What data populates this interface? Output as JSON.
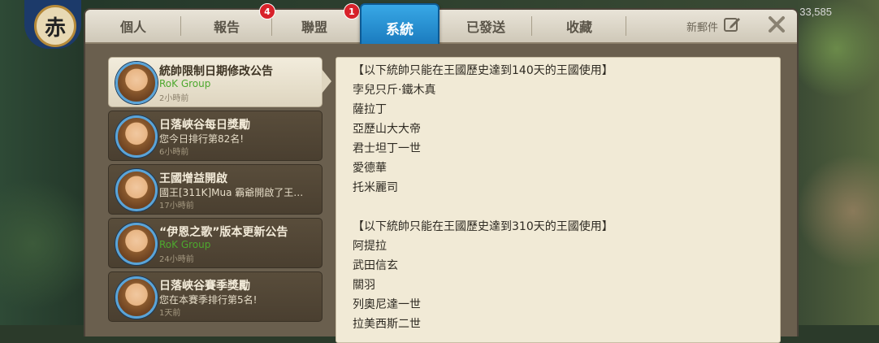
{
  "background": {
    "emblem_char": "赤",
    "count": "33,585"
  },
  "tabs": [
    {
      "label": "個人"
    },
    {
      "label": "報告",
      "badge": "4"
    },
    {
      "label": "聯盟",
      "badge": "1"
    },
    {
      "label": "系統",
      "active": true
    },
    {
      "label": "已發送"
    },
    {
      "label": "收藏"
    }
  ],
  "new_mail_label": "新郵件",
  "mail_list": [
    {
      "title": "統帥限制日期修改公告",
      "subtitle": "RoK Group",
      "time": "2小時前",
      "selected": true
    },
    {
      "title": "日落峽谷每日獎勵",
      "subtitle": "您今日排行第82名!",
      "time": "6小時前"
    },
    {
      "title": "王國增益開啟",
      "subtitle": "國王[311K]Mua 霸爺開啟了王…",
      "time": "17小時前"
    },
    {
      "title": "“伊恩之歌”版本更新公告",
      "subtitle": "RoK Group",
      "time": "24小時前"
    },
    {
      "title": "日落峽谷賽季獎勵",
      "subtitle": "您在本賽季排行第5名!",
      "time": "1天前"
    }
  ],
  "message_lines": [
    "【以下統帥只能在王國歷史達到140天的王國使用】",
    "孛兒只斤·鐵木真",
    "薩拉丁",
    "亞歷山大大帝",
    "君士坦丁一世",
    "愛德華",
    "托米麗司",
    "",
    "【以下統帥只能在王國歷史達到310天的王國使用】",
    "阿提拉",
    "武田信玄",
    "關羽",
    "列奧尼達一世",
    "拉美西斯二世"
  ],
  "colors": {
    "active_tab": "#1e88d0",
    "badge": "#d8222a",
    "group_name": "#4da82e"
  }
}
